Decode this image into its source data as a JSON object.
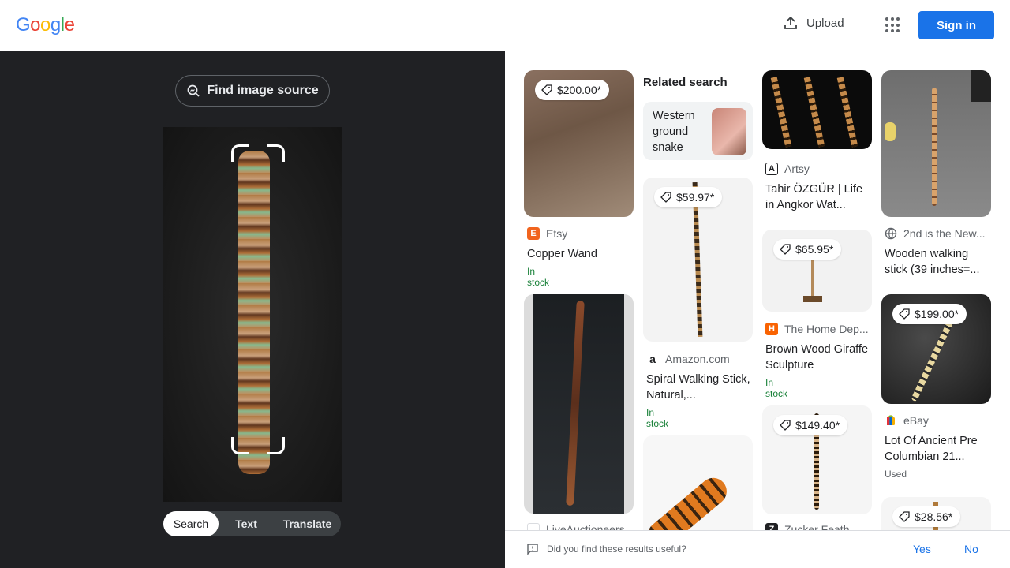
{
  "header": {
    "logo_letters": [
      "G",
      "o",
      "o",
      "g",
      "l",
      "e"
    ],
    "logo_colors": [
      "#4285f4",
      "#ea4335",
      "#fbbc05",
      "#4285f4",
      "#34a853",
      "#ea4335"
    ],
    "upload_label": "Upload",
    "apps_icon": "apps-grid-icon",
    "signin_label": "Sign in"
  },
  "left": {
    "find_source_label": "Find image source",
    "modes": [
      {
        "label": "Search",
        "active": true
      },
      {
        "label": "Text",
        "active": false
      },
      {
        "label": "Translate",
        "active": false
      }
    ]
  },
  "results": {
    "related_heading": "Related search",
    "related_item": "Western ground snake",
    "cards": [
      {
        "price": "$200.00*",
        "source": "Etsy",
        "title": "Copper Wand",
        "status": "In stock",
        "favicon_color": "#f1641e",
        "favicon_text": "E"
      },
      {
        "price": "$59.97*",
        "source": "Amazon.com",
        "title": "Spiral Walking Stick, Natural,...",
        "status": "In stock",
        "favicon_color": "#fff",
        "favicon_text": "a"
      },
      {
        "price": "",
        "source": "Artsy",
        "title": "Tahir ÖZGÜR | Life in Angkor Wat...",
        "status": "",
        "favicon_color": "#fff",
        "favicon_text": "A"
      },
      {
        "price": "$65.95*",
        "source": "The Home Dep...",
        "title": "Brown Wood Giraffe Sculpture",
        "status": "In stock",
        "favicon_color": "#f96302",
        "favicon_text": "H"
      },
      {
        "price": "$149.40*",
        "source": "Zucker Feath...",
        "title": "",
        "status": "",
        "favicon_color": "#202124",
        "favicon_text": "Z"
      },
      {
        "price": "",
        "source": "2nd is the New...",
        "title": "Wooden walking stick (39 inches=...",
        "status": "",
        "favicon_color": "#fff",
        "favicon_text": ""
      },
      {
        "price": "$199.00*",
        "source": "eBay",
        "title": "Lot Of Ancient Pre Columbian 21...",
        "status": "Used",
        "favicon_color": "#fff",
        "favicon_text": ""
      },
      {
        "price": "$28.56*",
        "source": "",
        "title": "",
        "status": "",
        "favicon_color": "#fff",
        "favicon_text": ""
      },
      {
        "price": "",
        "source": "LiveAuctioneers",
        "title": "",
        "status": "",
        "favicon_color": "#fff",
        "favicon_text": ""
      }
    ]
  },
  "feedback": {
    "question": "Did you find these results useful?",
    "yes_label": "Yes",
    "no_label": "No"
  }
}
